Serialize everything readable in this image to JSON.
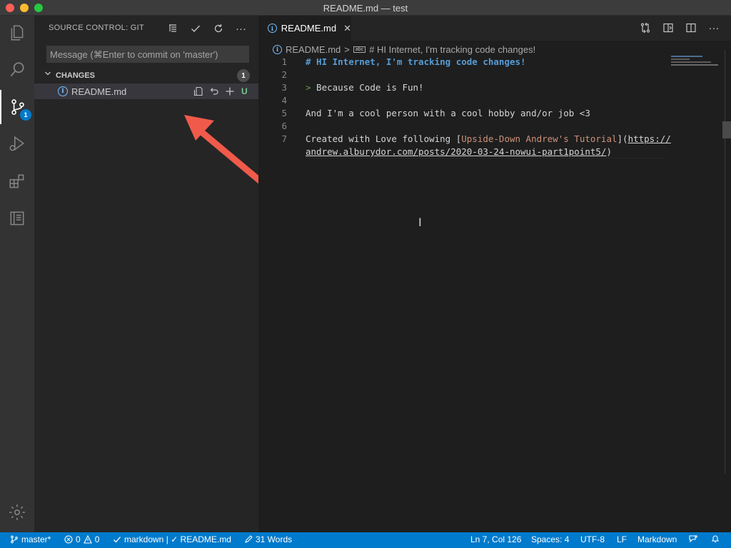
{
  "window": {
    "title": "README.md — test"
  },
  "activity_bar": {
    "items": [
      "explorer-icon",
      "search-icon",
      "source-control-icon",
      "run-debug-icon",
      "extensions-icon",
      "notebook-icon"
    ],
    "source_control_badge": "1",
    "settings": "gear-icon"
  },
  "sidebar": {
    "title": "SOURCE CONTROL: GIT",
    "commit_placeholder": "Message (⌘Enter to commit on 'master')",
    "changes_label": "CHANGES",
    "changes_count": "1",
    "file": {
      "name": "README.md",
      "status": "U"
    }
  },
  "editor": {
    "tab_label": "README.md",
    "tab_close": "✕",
    "breadcrumb": {
      "file": "README.md",
      "separator": ">",
      "symbol_tag": "abc",
      "symbol": "# HI Internet, I'm tracking code changes!"
    },
    "lines": [
      {
        "n": "1",
        "heading": "# HI Internet, I'm tracking code changes!"
      },
      {
        "n": "2"
      },
      {
        "n": "3",
        "quote_mark": ">",
        "text": " Because Code is Fun!"
      },
      {
        "n": "4"
      },
      {
        "n": "5",
        "text": "And I'm a cool person with a cool hobby and/or job <3"
      },
      {
        "n": "6"
      },
      {
        "n": "7",
        "pre": "Created with Love following [",
        "link_text": "Upside-Down Andrew's Tutorial",
        "mid": "](",
        "url_1": "https://",
        "url_2": "andrew.alburydor.com/posts/2020-03-24-nowui-part1point5/",
        "post": ")"
      }
    ]
  },
  "statusbar": {
    "branch": "master*",
    "errors": "0",
    "warnings": "0",
    "lint": "markdown | ✓ README.md",
    "words": "31 Words",
    "position": "Ln 7, Col 126",
    "spaces": "Spaces: 4",
    "encoding": "UTF-8",
    "eol": "LF",
    "language": "Markdown"
  },
  "colors": {
    "accent": "#007acc",
    "annotation_arrow": "#f05a4a",
    "untracked": "#73c991",
    "heading": "#569cd6",
    "link": "#ce9178"
  }
}
